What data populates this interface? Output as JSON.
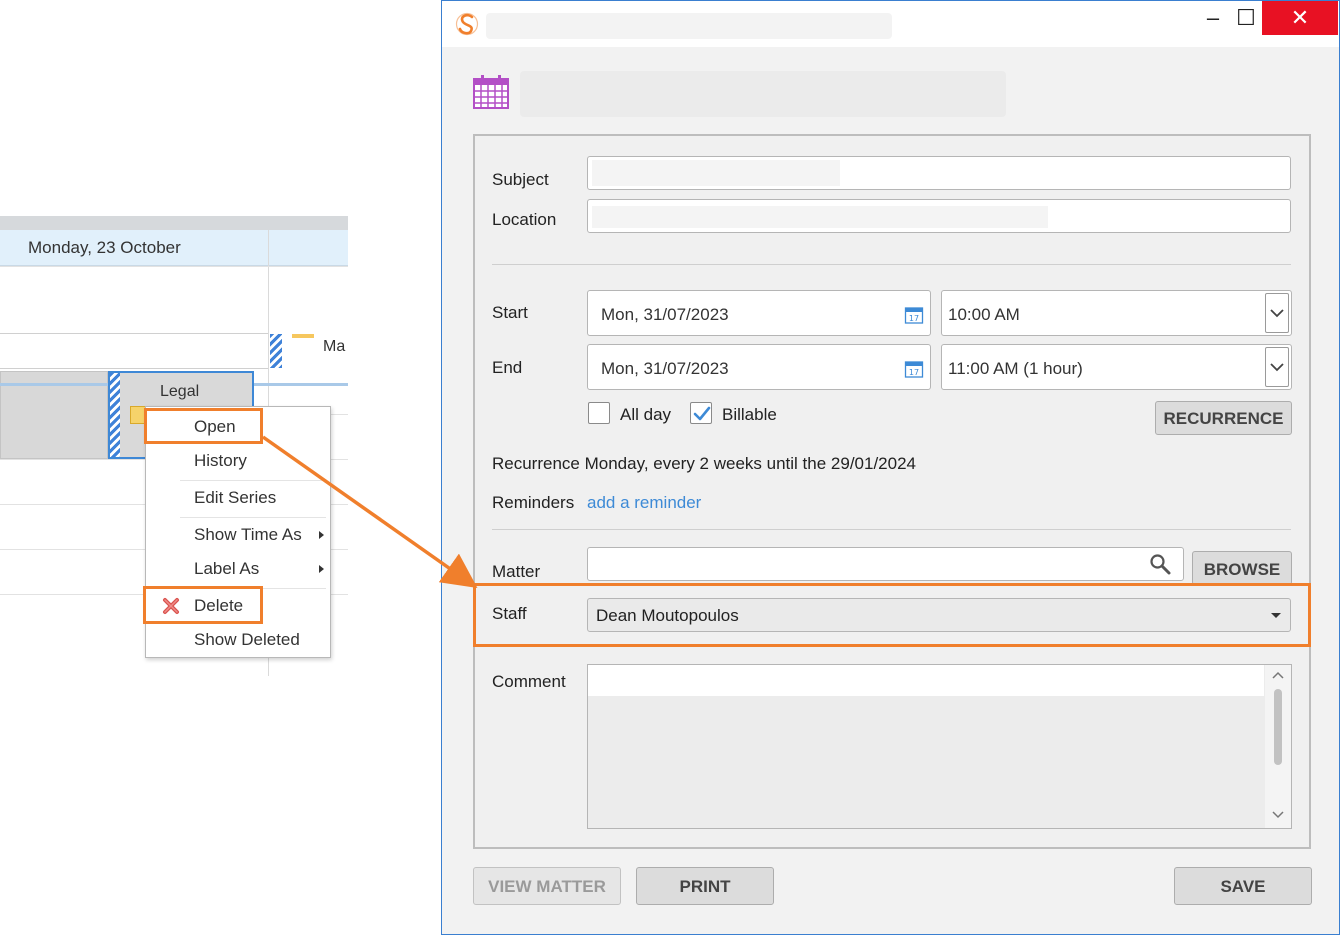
{
  "calendar": {
    "day_header": "Monday, 23 October",
    "appointment_label": "Legal",
    "next_appointment_label": "Ma"
  },
  "context_menu": {
    "items": [
      {
        "label": "Open",
        "highlighted": true
      },
      {
        "label": "History"
      },
      {
        "label": "Edit Series"
      },
      {
        "label": "Show Time As",
        "submenu": true
      },
      {
        "label": "Label As",
        "submenu": true
      },
      {
        "label": "Delete",
        "highlighted": true,
        "icon": "red-x-icon"
      },
      {
        "label": "Show Deleted"
      }
    ]
  },
  "window": {
    "app_icon": "orange-s-logo-icon",
    "controls": {
      "minimize": "–",
      "maximize": "☐",
      "close": "✕"
    },
    "header_icon": "calendar-grid-icon"
  },
  "form": {
    "subject_label": "Subject",
    "location_label": "Location",
    "start_label": "Start",
    "end_label": "End",
    "start_date": "Mon, 31/07/2023",
    "start_time": "10:00 AM",
    "end_date": "Mon, 31/07/2023",
    "end_time": "11:00 AM (1 hour)",
    "all_day_label": "All day",
    "all_day_checked": false,
    "billable_label": "Billable",
    "billable_checked": true,
    "recurrence_button": "RECURRENCE",
    "recurrence_text": "Recurrence Monday, every 2 weeks until the 29/01/2024",
    "reminders_label": "Reminders",
    "reminders_link": "add a reminder",
    "matter_label": "Matter",
    "browse_button": "BROWSE",
    "staff_label": "Staff",
    "staff_value": "Dean Moutopoulos",
    "comment_label": "Comment"
  },
  "footer": {
    "view_matter_button": "VIEW MATTER",
    "print_button": "PRINT",
    "save_button": "SAVE"
  },
  "colors": {
    "highlight_orange": "#f07f2c",
    "link_blue": "#3d8ad6",
    "close_red": "#e81123",
    "calendar_icon_purple": "#b34fc6"
  }
}
